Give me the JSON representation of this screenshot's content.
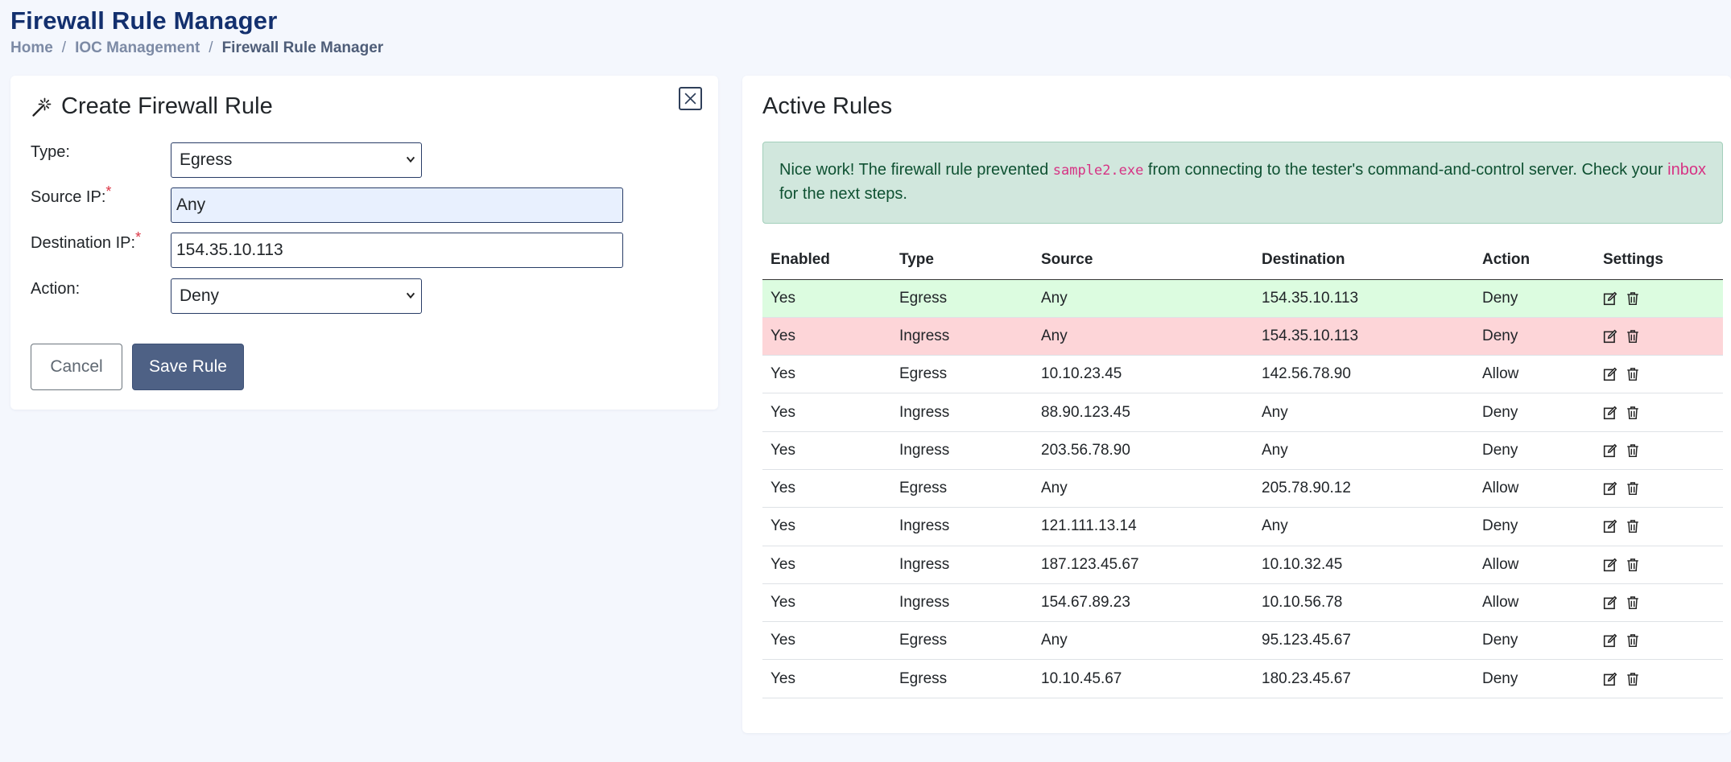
{
  "page": {
    "title": "Firewall Rule Manager",
    "breadcrumb": [
      "Home",
      "IOC Management",
      "Firewall Rule Manager"
    ]
  },
  "create_form": {
    "title": "Create Firewall Rule",
    "title_icon": "magic-wand-icon",
    "close_icon": "close-icon",
    "type_label": "Type:",
    "type_value": "Egress",
    "source_label": "Source IP:",
    "source_value": "Any",
    "dest_label": "Destination IP:",
    "dest_value": "154.35.10.113",
    "action_label": "Action:",
    "action_value": "Deny",
    "required_mark": "*",
    "cancel_label": "Cancel",
    "save_label": "Save Rule"
  },
  "active_rules": {
    "title": "Active Rules",
    "alert": {
      "text_before": "Nice work! The firewall rule prevented ",
      "code": "sample2.exe",
      "text_middle": " from connecting to the tester's command-and-control server. Check your ",
      "link": "inbox",
      "text_after": " for the next steps."
    },
    "columns": [
      "Enabled",
      "Type",
      "Source",
      "Destination",
      "Action",
      "Settings"
    ],
    "rows": [
      {
        "enabled": "Yes",
        "type": "Egress",
        "source": "Any",
        "destination": "154.35.10.113",
        "action": "Deny",
        "highlight": "green"
      },
      {
        "enabled": "Yes",
        "type": "Ingress",
        "source": "Any",
        "destination": "154.35.10.113",
        "action": "Deny",
        "highlight": "red"
      },
      {
        "enabled": "Yes",
        "type": "Egress",
        "source": "10.10.23.45",
        "destination": "142.56.78.90",
        "action": "Allow",
        "highlight": ""
      },
      {
        "enabled": "Yes",
        "type": "Ingress",
        "source": "88.90.123.45",
        "destination": "Any",
        "action": "Deny",
        "highlight": ""
      },
      {
        "enabled": "Yes",
        "type": "Ingress",
        "source": "203.56.78.90",
        "destination": "Any",
        "action": "Deny",
        "highlight": ""
      },
      {
        "enabled": "Yes",
        "type": "Egress",
        "source": "Any",
        "destination": "205.78.90.12",
        "action": "Allow",
        "highlight": ""
      },
      {
        "enabled": "Yes",
        "type": "Ingress",
        "source": "121.111.13.14",
        "destination": "Any",
        "action": "Deny",
        "highlight": ""
      },
      {
        "enabled": "Yes",
        "type": "Ingress",
        "source": "187.123.45.67",
        "destination": "10.10.32.45",
        "action": "Allow",
        "highlight": ""
      },
      {
        "enabled": "Yes",
        "type": "Ingress",
        "source": "154.67.89.23",
        "destination": "10.10.56.78",
        "action": "Allow",
        "highlight": ""
      },
      {
        "enabled": "Yes",
        "type": "Egress",
        "source": "Any",
        "destination": "95.123.45.67",
        "action": "Deny",
        "highlight": ""
      },
      {
        "enabled": "Yes",
        "type": "Egress",
        "source": "10.10.45.67",
        "destination": "180.23.45.67",
        "action": "Deny",
        "highlight": ""
      }
    ],
    "row_icons": [
      "edit-icon",
      "trash-icon"
    ]
  },
  "colors": {
    "background": "#f4f7fd",
    "title": "#13306e",
    "primary_button": "#4e6185",
    "alert_bg": "#d1e7dd",
    "row_allowed_highlight": "#dcfce0",
    "row_blocked_highlight": "#fdd5d8",
    "required": "#dc3545"
  }
}
